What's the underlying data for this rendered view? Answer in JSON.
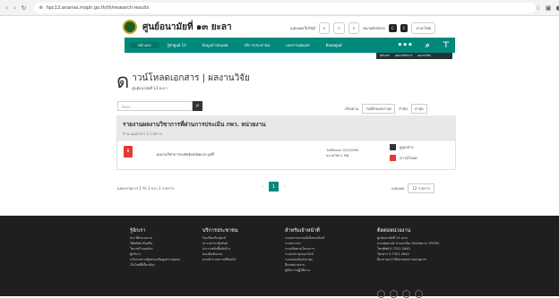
{
  "browser": {
    "url": "hpc13.anamai.moph.go.th/th/research-results"
  },
  "header": {
    "site_name": "ศูนย์อนามัยที่ ๑๓ ยะลา",
    "search_label": "แสดงผลเว็บไซต์",
    "font_label": "ขนาดตัวอักษร",
    "font_sizes": [
      "ก",
      "ก",
      "ก"
    ],
    "contrast_label": "การแสดงผล",
    "contrast_options": [
      "C",
      "C",
      "C"
    ],
    "lang": "ภาษาไทย"
  },
  "menu": {
    "items": [
      "หน้าแรก",
      "รู้จักศูนย์ 13",
      "ข้อมูลสารสนเทศ",
      "บริการประชาชน",
      "เอกสารเผยแพร่",
      "ติดต่อศูนย์"
    ]
  },
  "breadcrumb": [
    "หน้าแรก",
    "ผลงานวิชาการ",
    "ผลงานวิจัย"
  ],
  "page": {
    "title_char": "ด",
    "title": "าวน์โหลดเอกสาร | ผลงานวิจัย",
    "subtitle": "ศูนย์อนามัยที่ 13 ยะลา"
  },
  "filter": {
    "placeholder": "ค้นหา",
    "sort_label": "เรียงตาม",
    "sort_value": "วันที่อัปเดตล่าสุด",
    "order_label": "ลำดับ",
    "order_value": "ล่าสุด"
  },
  "document": {
    "title": "รายงานผลงานวิชาการที่ผ่านการประเมิน กพว. หน่วยงาน",
    "meta": "จำนวนเอกสาร 1 รายการ",
    "file_name": "ผลงานวิชาการระดับจังหวัดยะลา.pdf",
    "file_date": "วันที่อัปเดต 15/2/2568",
    "file_size": "ขนาดไฟล์ 1 MB",
    "view_label": "ดูเอกสาร",
    "download_label": "ดาวน์โหลด"
  },
  "pager": {
    "info": "แสดงรายการ 1 ถึง 1 จาก 1 รายการ",
    "prev": "‹",
    "current": "1",
    "next": "›",
    "perpage_label": "แสดงผล",
    "perpage_value": "12 รายการ"
  },
  "footer": {
    "col1": {
      "title": "รู้จักเรา",
      "items": [
        "ประวัติหน่วยงาน",
        "วิสัยทัศน์ พันธกิจ",
        "โครงสร้างองค์กร",
        "ผู้บริหาร",
        "นโยบายการคุ้มครองข้อมูลส่วนบุคคล",
        "เว็บไซต์ที่เกี่ยวข้อง"
      ]
    },
    "col2": {
      "title": "บริการประชาชน",
      "items": [
        "ร้องเรียนร้องทุกข์",
        "ข่าวประชาสัมพันธ์",
        "ประกาศจัดซื้อจัดจ้าง",
        "ตอบข้อซักถาม",
        "แบบสำรวจความพึงพอใจ"
      ]
    },
    "col3": {
      "title": "สำหรับเจ้าหน้าที่",
      "items": [
        "ระบบสารบรรณอิเล็กทรอนิกส์",
        "ระบบการลา",
        "ระบบติดตามโครงการ",
        "ระบบประชุมออนไลน์",
        "ระบบจองห้องประชุม",
        "อีเมลหน่วยงาน",
        "คู่มือการปฏิบัติงาน"
      ]
    },
    "col4": {
      "title": "ติดต่อหน่วยงาน",
      "items": [
        "ศูนย์อนามัยที่ 13 ยะลา",
        "ถนนสุขยางค์ อำเภอเมือง จังหวัดยะลา 95000",
        "โทรศัพท์ 0-7321-2640",
        "โทรสาร 0-7321-2640",
        "อีเมล hpc13@anamai.mail.go.th"
      ]
    }
  }
}
